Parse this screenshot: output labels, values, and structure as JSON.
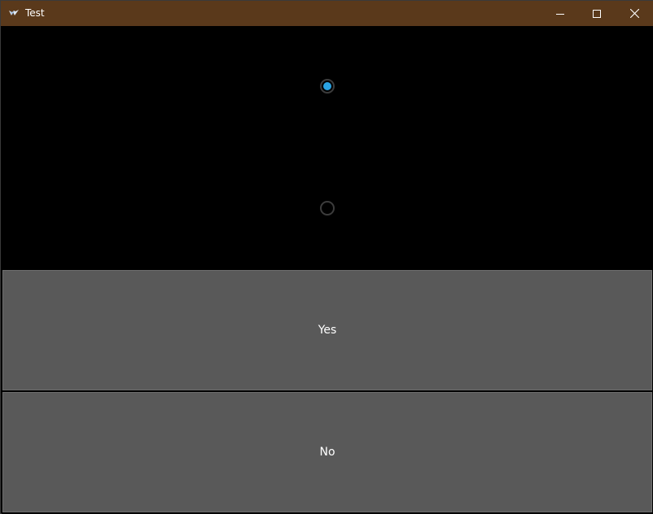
{
  "window": {
    "title": "Test",
    "app_icon": "kivy-icon",
    "controls": {
      "minimize_icon": "minimize-icon",
      "maximize_icon": "maximize-icon",
      "close_icon": "close-icon"
    },
    "titlebar_color": "#5a391b"
  },
  "radios": [
    {
      "state": "checked"
    },
    {
      "state": "unchecked"
    }
  ],
  "accent_color": "#2aa3e3",
  "buttons": {
    "yes_label": "Yes",
    "no_label": "No"
  }
}
